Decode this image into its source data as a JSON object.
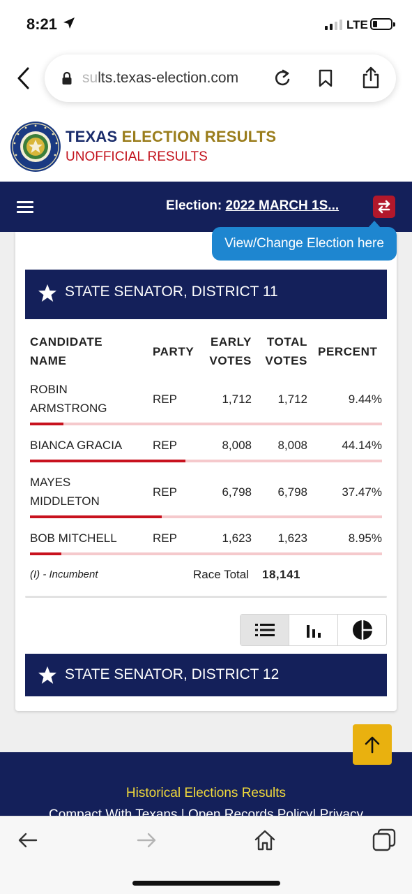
{
  "status_bar": {
    "time": "8:21",
    "network": "LTE"
  },
  "browser": {
    "url_faded": "su",
    "url_main": "lts.texas-election.com"
  },
  "site": {
    "title_part1": "TEXAS",
    "title_part2": "ELECTION RESULTS",
    "subtitle": "UNOFFICIAL RESULTS"
  },
  "nav": {
    "election_label": "Election:",
    "election_value": "2022 MARCH 1S...",
    "tooltip": "View/Change Election here"
  },
  "race1": {
    "title": "STATE SENATOR, DISTRICT 11",
    "headers": {
      "candidate_line1": "CANDIDATE",
      "candidate_line2": "NAME",
      "party": "PARTY",
      "early_line1": "EARLY",
      "early_line2": "VOTES",
      "total_line1": "TOTAL",
      "total_line2": "VOTES",
      "percent": "PERCENT"
    },
    "rows": [
      {
        "name_line1": "ROBIN",
        "name_line2": "ARMSTRONG",
        "party": "REP",
        "early": "1,712",
        "total": "1,712",
        "percent": "9.44%",
        "share": 0.0944
      },
      {
        "name_line1": "BIANCA GRACIA",
        "name_line2": "",
        "party": "REP",
        "early": "8,008",
        "total": "8,008",
        "percent": "44.14%",
        "share": 0.4414
      },
      {
        "name_line1": "MAYES",
        "name_line2": "MIDDLETON",
        "party": "REP",
        "early": "6,798",
        "total": "6,798",
        "percent": "37.47%",
        "share": 0.3747
      },
      {
        "name_line1": "BOB MITCHELL",
        "name_line2": "",
        "party": "REP",
        "early": "1,623",
        "total": "1,623",
        "percent": "8.95%",
        "share": 0.0895
      }
    ],
    "incumbent_note": "(I) - Incumbent",
    "race_total_label": "Race Total",
    "race_total_value": "18,141"
  },
  "race2": {
    "title": "STATE SENATOR, DISTRICT 12"
  },
  "view_toggle": {
    "icons": [
      "list-icon",
      "bar-chart-icon",
      "pie-chart-icon"
    ],
    "active": "list"
  },
  "footer": {
    "historical": "Historical Elections Results",
    "links": "Compact With Texans | Open Records Policy| Privacy"
  },
  "colors": {
    "navy": "#14205a",
    "red": "#c8121e",
    "gold": "#9a7d1c",
    "tooltip_blue": "#1e86d0",
    "scroll_yellow": "#e9b10f"
  }
}
